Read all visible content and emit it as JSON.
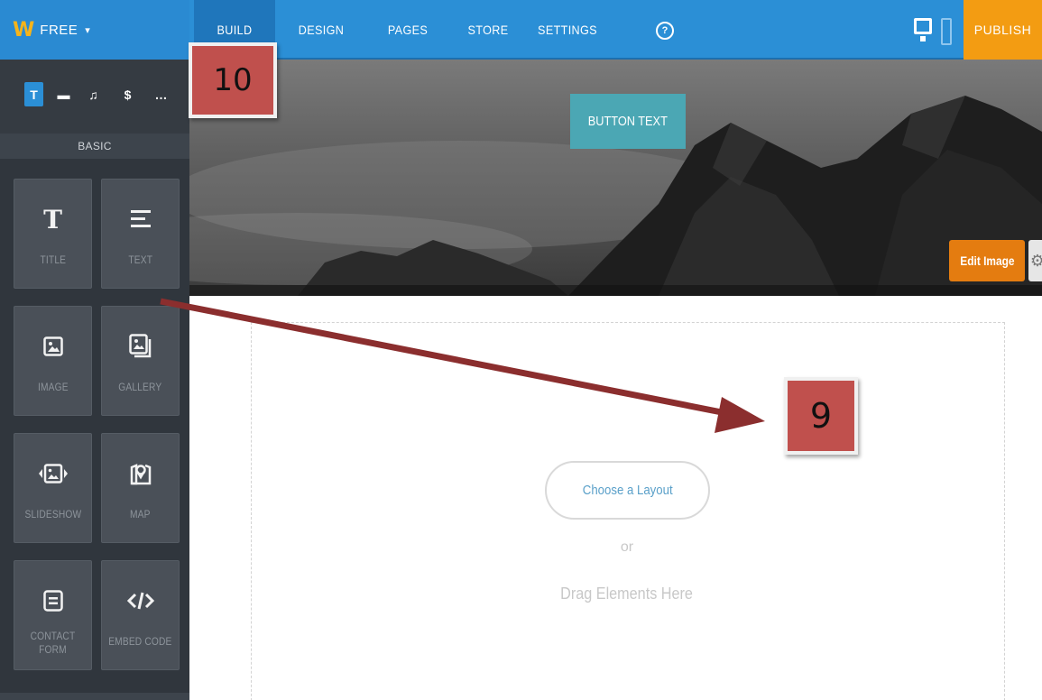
{
  "topbar": {
    "plan_label": "FREE",
    "nav": [
      "BUILD",
      "DESIGN",
      "PAGES",
      "STORE",
      "SETTINGS"
    ],
    "active_tab": "BUILD",
    "help_label": "?",
    "publish_label": "PUBLISH",
    "colors": {
      "bar": "#2b8fd6",
      "publish": "#f39c12",
      "logo": "#f6b41a"
    }
  },
  "sidebar": {
    "category_tabs": [
      "T",
      "▬",
      "♫",
      "$",
      "…"
    ],
    "section_label": "BASIC",
    "tiles": [
      {
        "label": "TITLE",
        "icon": "title-icon"
      },
      {
        "label": "TEXT",
        "icon": "text-icon"
      },
      {
        "label": "IMAGE",
        "icon": "image-icon"
      },
      {
        "label": "GALLERY",
        "icon": "gallery-icon"
      },
      {
        "label": "SLIDESHOW",
        "icon": "slideshow-icon"
      },
      {
        "label": "MAP",
        "icon": "map-icon"
      },
      {
        "label": "CONTACT FORM",
        "icon": "contact-form-icon"
      },
      {
        "label": "EMBED CODE",
        "icon": "embed-code-icon"
      }
    ]
  },
  "hero": {
    "button_text": "BUTTON TEXT",
    "edit_image_label": "Edit Image"
  },
  "content": {
    "choose_layout": "Choose a Layout",
    "or": "or",
    "drag_hint": "Drag Elements Here"
  },
  "annotations": {
    "callout_a": "10",
    "callout_b": "9",
    "color": "#c0504d",
    "arrow_color": "#8b2e2e"
  }
}
